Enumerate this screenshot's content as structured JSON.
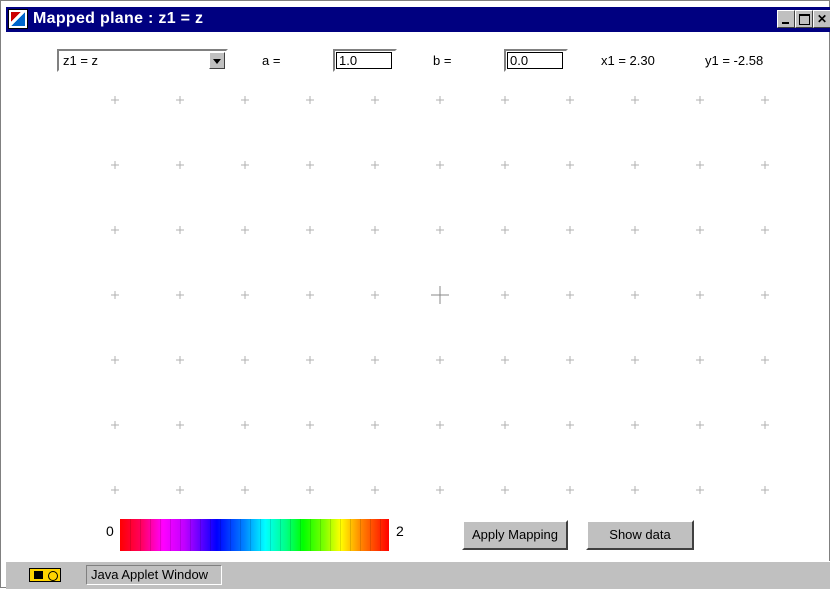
{
  "window": {
    "title": "Mapped plane : z1 = z",
    "app_icon": "java-cup-icon",
    "title_bar_color": "#000080",
    "controls": [
      "minimize-icon",
      "maximize-icon",
      "close-icon"
    ]
  },
  "controls": {
    "mapping_select": {
      "value": "z1 = z"
    },
    "a_label": "a =",
    "a_value": "1.0",
    "b_label": "b =",
    "b_value": "0.0",
    "x1_readout": "x1 =  2.30",
    "y1_readout": "y1 = -2.58"
  },
  "grid": {
    "columns": 11,
    "rows": 7,
    "marker": "+",
    "marker_color": "#b0b0b0",
    "origin_marker": "large plus at column 6, row 4"
  },
  "colorbar": {
    "min_label": "0",
    "max_label": "2"
  },
  "buttons": {
    "apply_mapping": "Apply Mapping",
    "show_data": "Show data"
  },
  "status": {
    "text": "Java Applet Window",
    "icon": "java-coffee-icon"
  }
}
